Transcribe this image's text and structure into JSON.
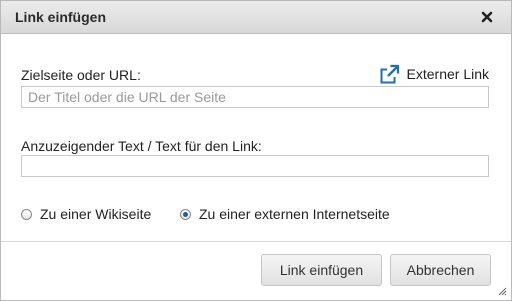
{
  "dialog": {
    "title": "Link einfügen",
    "close_icon": "close-icon"
  },
  "target": {
    "label": "Zielseite oder URL:",
    "placeholder": "Der Titel oder die URL der Seite",
    "value": "",
    "external_link_label": "Externer Link",
    "external_link_icon": "external-link-icon"
  },
  "display_text": {
    "label": "Anzuzeigender Text / Text für den Link:",
    "value": ""
  },
  "link_type": {
    "options": [
      {
        "label": "Zu einer Wikiseite",
        "checked": false
      },
      {
        "label": "Zu einer externen Internetseite",
        "checked": true
      }
    ]
  },
  "buttons": {
    "insert": "Link einfügen",
    "cancel": "Abbrechen"
  },
  "colors": {
    "accent": "#1f5f9c",
    "titlebar": "#e2e2e2"
  }
}
